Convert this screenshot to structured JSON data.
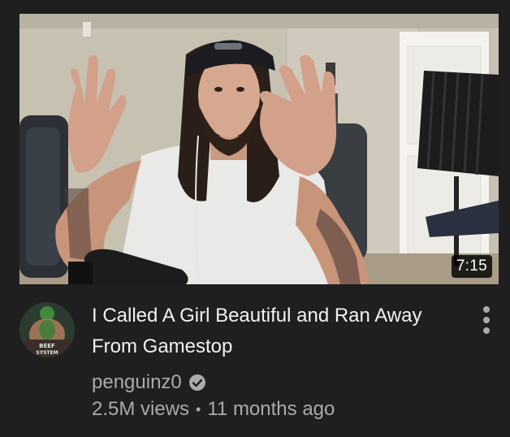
{
  "video": {
    "duration": "7:15",
    "title": "I Called A Girl Beautiful and Ran Away From Gamestop",
    "channel": "penguinz0",
    "views": "2.5M views",
    "separator": "•",
    "age": "11 months ago"
  },
  "avatar": {
    "text_lines": [
      "BEEF",
      "SYSTEM"
    ]
  },
  "icons": {
    "more": "more-vert-icon",
    "verified": "verified-check-icon"
  },
  "colors": {
    "background": "#1f1f1f",
    "title": "#f1f1f1",
    "secondary": "#aaaaaa",
    "badge": "#000000"
  }
}
